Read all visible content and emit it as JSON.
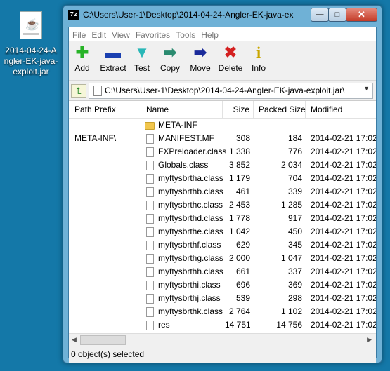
{
  "desktop": {
    "icon_label": "2014-04-24-Angler-EK-java-exploit.jar"
  },
  "window": {
    "app_icon_text": "7z",
    "title": "C:\\Users\\User-1\\Desktop\\2014-04-24-Angler-EK-java-ex...",
    "minimize_glyph": "—",
    "maximize_glyph": "□",
    "close_glyph": "✕"
  },
  "menu": [
    "File",
    "Edit",
    "View",
    "Favorites",
    "Tools",
    "Help"
  ],
  "toolbar": {
    "add": {
      "label": "Add",
      "glyph": "✚",
      "color": "#27b327"
    },
    "extract": {
      "label": "Extract",
      "glyph": "▬",
      "color": "#1a3fb0"
    },
    "test": {
      "label": "Test",
      "glyph": "▼",
      "color": "#2ab7b7"
    },
    "copy": {
      "label": "Copy",
      "glyph": "➡",
      "color": "#2a8a6f"
    },
    "move": {
      "label": "Move",
      "glyph": "➡",
      "color": "#1a2a9a"
    },
    "delete": {
      "label": "Delete",
      "glyph": "✖",
      "color": "#d42020"
    },
    "info": {
      "label": "Info",
      "glyph": "i",
      "color": "#c9a600"
    }
  },
  "address": {
    "path": "C:\\Users\\User-1\\Desktop\\2014-04-24-Angler-EK-java-exploit.jar\\",
    "up_glyph": "⮤",
    "dropdown_glyph": "▼"
  },
  "columns": {
    "prefix": "Path Prefix",
    "name": "Name",
    "size": "Size",
    "packed": "Packed Size",
    "modified": "Modified"
  },
  "rows": [
    {
      "type": "folder",
      "prefix": "",
      "name": "META-INF",
      "size": "",
      "packed": "",
      "modified": ""
    },
    {
      "type": "file",
      "prefix": "META-INF\\",
      "name": "MANIFEST.MF",
      "size": "308",
      "packed": "184",
      "modified": "2014-02-21 17:02"
    },
    {
      "type": "file",
      "prefix": "",
      "name": "FXPreloader.class",
      "size": "1 338",
      "packed": "776",
      "modified": "2014-02-21 17:02"
    },
    {
      "type": "file",
      "prefix": "",
      "name": "Globals.class",
      "size": "3 852",
      "packed": "2 034",
      "modified": "2014-02-21 17:02"
    },
    {
      "type": "file",
      "prefix": "",
      "name": "myftysbrtha.class",
      "size": "1 179",
      "packed": "704",
      "modified": "2014-02-21 17:02"
    },
    {
      "type": "file",
      "prefix": "",
      "name": "myftysbrthb.class",
      "size": "461",
      "packed": "339",
      "modified": "2014-02-21 17:02"
    },
    {
      "type": "file",
      "prefix": "",
      "name": "myftysbrthc.class",
      "size": "2 453",
      "packed": "1 285",
      "modified": "2014-02-21 17:02"
    },
    {
      "type": "file",
      "prefix": "",
      "name": "myftysbrthd.class",
      "size": "1 778",
      "packed": "917",
      "modified": "2014-02-21 17:02"
    },
    {
      "type": "file",
      "prefix": "",
      "name": "myftysbrthe.class",
      "size": "1 042",
      "packed": "450",
      "modified": "2014-02-21 17:02"
    },
    {
      "type": "file",
      "prefix": "",
      "name": "myftysbrthf.class",
      "size": "629",
      "packed": "345",
      "modified": "2014-02-21 17:02"
    },
    {
      "type": "file",
      "prefix": "",
      "name": "myftysbrthg.class",
      "size": "2 000",
      "packed": "1 047",
      "modified": "2014-02-21 17:02"
    },
    {
      "type": "file",
      "prefix": "",
      "name": "myftysbrthh.class",
      "size": "661",
      "packed": "337",
      "modified": "2014-02-21 17:02"
    },
    {
      "type": "file",
      "prefix": "",
      "name": "myftysbrthi.class",
      "size": "696",
      "packed": "369",
      "modified": "2014-02-21 17:02"
    },
    {
      "type": "file",
      "prefix": "",
      "name": "myftysbrthj.class",
      "size": "539",
      "packed": "298",
      "modified": "2014-02-21 17:02"
    },
    {
      "type": "file",
      "prefix": "",
      "name": "myftysbrthk.class",
      "size": "2 764",
      "packed": "1 102",
      "modified": "2014-02-21 17:02"
    },
    {
      "type": "file",
      "prefix": "",
      "name": "res",
      "size": "14 751",
      "packed": "14 756",
      "modified": "2014-02-21 17:02"
    }
  ],
  "scrollbar": {
    "left_glyph": "◀",
    "right_glyph": "▶"
  },
  "status": "0 object(s) selected"
}
